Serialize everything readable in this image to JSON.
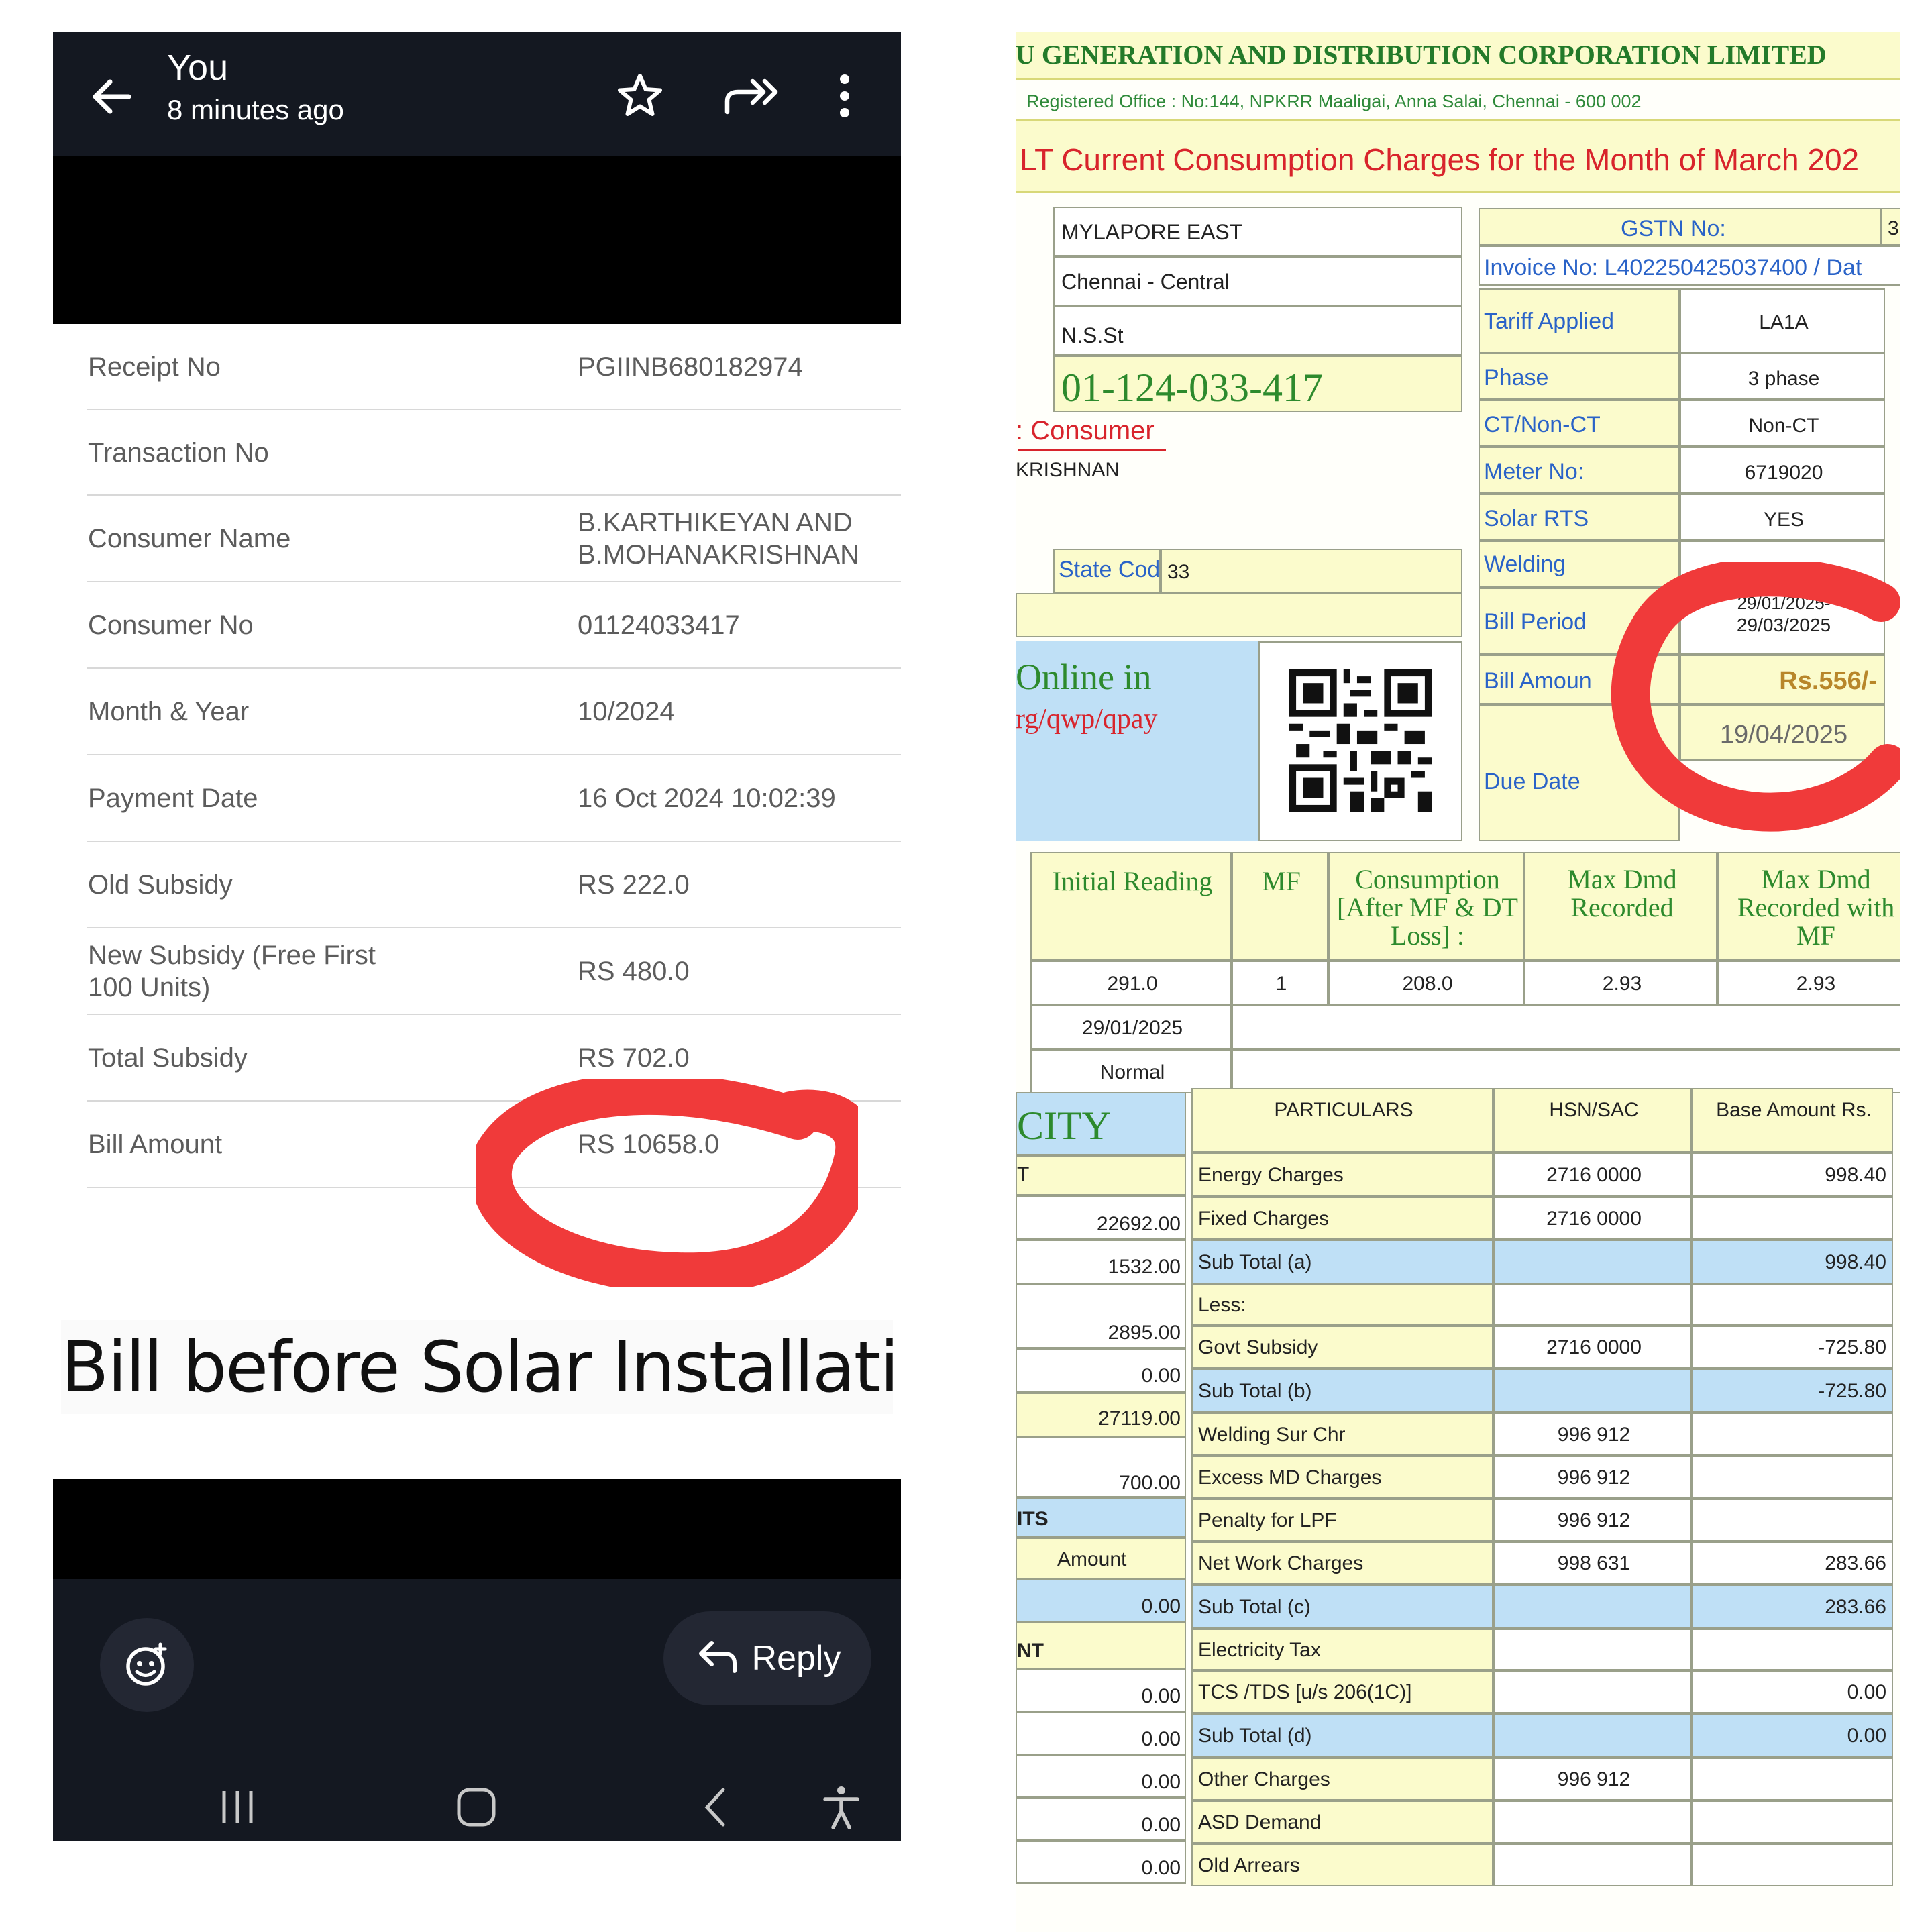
{
  "header": {
    "title": "You",
    "subtitle": "8 minutes ago",
    "icons": [
      "back-arrow-icon",
      "star-icon",
      "forward-icon",
      "more-vert-icon"
    ]
  },
  "receipt": {
    "rows": [
      {
        "label": "Receipt No",
        "value": "PGIINB680182974"
      },
      {
        "label": "Transaction No",
        "value": ""
      },
      {
        "label": "Consumer Name",
        "value_line1": "B.KARTHIKEYAN  AND",
        "value_line2": "B.MOHANAKRISHNAN"
      },
      {
        "label": "Consumer No",
        "value": "01124033417"
      },
      {
        "label": "Month & Year",
        "value": "10/2024"
      },
      {
        "label": "Payment Date",
        "value": "16 Oct 2024 10:02:39"
      },
      {
        "label": "Old Subsidy",
        "value": "RS 222.0"
      },
      {
        "label_line1": "New Subsidy (Free First",
        "label_line2": "100 Units)",
        "value": "RS 480.0"
      },
      {
        "label": "Total Subsidy",
        "value": "RS 702.0"
      },
      {
        "label": "Bill Amount",
        "value": "RS 10658.0"
      }
    ]
  },
  "caption": "Bill before Solar Installation",
  "footer": {
    "reply_label": "Reply",
    "icons": [
      "emoji-add-icon",
      "reply-arrow-icon",
      "recents-icon",
      "home-icon",
      "back-icon",
      "accessibility-icon"
    ]
  },
  "annotation_color": "#f03a3a",
  "bill": {
    "corp_title": "U GENERATION AND DISTRIBUTION CORPORATION LIMITED",
    "registered_office": "Registered Office : No:144, NPKRR Maaligai, Anna Salai, Chennai - 600 002",
    "charges_title": "LT Current Consumption Charges for the Month of March  202",
    "address": {
      "line1": "MYLAPORE EAST",
      "line2": "Chennai - Central",
      "line3": "N.S.St",
      "consumer_no": "01-124-033-417",
      "consumer_label": ": Consumer",
      "consumer_name": "KRISHNAN",
      "state_code_label": "State Code",
      "state_code": "33"
    },
    "pay_online": {
      "line1": "Online in",
      "line2": "rg/qwp/qpay"
    },
    "gstn_label": "GSTN No:",
    "gstn_value": "3",
    "invoice": "Invoice No: L402250425037400 / Dat",
    "details": [
      {
        "label": "Tariff Applied",
        "value": "LA1A"
      },
      {
        "label": "Phase",
        "value": "3 phase"
      },
      {
        "label": "CT/Non-CT",
        "value": "Non-CT"
      },
      {
        "label": "Meter No:",
        "value": "6719020"
      },
      {
        "label": "Solar RTS",
        "value": "YES"
      },
      {
        "label": "Welding",
        "value": ""
      },
      {
        "label": "Bill Period",
        "value": "29/03/2025"
      },
      {
        "label": "Bill Amoun",
        "value": "Rs.556/-"
      },
      {
        "label": "Due Date",
        "value": "19/04/2025"
      }
    ],
    "bill_period_top": "29/01/2025-",
    "reading_headers": [
      "Initial Reading",
      "MF",
      "Consumption [After MF & DT Loss] :",
      "Max Dmd Recorded",
      "Max Dmd Recorded with MF"
    ],
    "reading_row1": [
      "291.0",
      "1",
      "208.0",
      "2.93",
      "2.93"
    ],
    "reading_row2": "29/01/2025",
    "reading_row3": "Normal",
    "left_col": {
      "city": "CITY",
      "marker_t": "T",
      "its": "ITS",
      "amount": "Amount",
      "nt": "NT",
      "values": [
        "22692.00",
        "1532.00",
        "2895.00",
        "0.00",
        "27119.00",
        "700.00",
        "0.00",
        "0.00",
        "0.00",
        "0.00",
        "0.00",
        "0.00"
      ]
    },
    "particulars_headers": [
      "PARTICULARS",
      "HSN/SAC",
      "Base Amount Rs."
    ],
    "particulars": [
      {
        "name": "Energy Charges",
        "hsn": "2716 0000",
        "amount": "998.40"
      },
      {
        "name": "Fixed Charges",
        "hsn": "2716 0000",
        "amount": ""
      },
      {
        "name": "Sub Total (a)",
        "hsn": "",
        "amount": "998.40"
      },
      {
        "name": "Less:",
        "hsn": "",
        "amount": ""
      },
      {
        "name": "Govt Subsidy",
        "hsn": "2716 0000",
        "amount": "-725.80"
      },
      {
        "name": "Sub Total (b)",
        "hsn": "",
        "amount": "-725.80"
      },
      {
        "name": "Welding Sur Chr",
        "hsn": "996 912",
        "amount": ""
      },
      {
        "name": "Excess MD Charges",
        "hsn": "996 912",
        "amount": ""
      },
      {
        "name": "Penalty for LPF",
        "hsn": "996 912",
        "amount": ""
      },
      {
        "name": "Net Work Charges",
        "hsn": "998 631",
        "amount": "283.66"
      },
      {
        "name": "Sub Total (c)",
        "hsn": "",
        "amount": "283.66"
      },
      {
        "name": "Electricity Tax",
        "hsn": "",
        "amount": ""
      },
      {
        "name": "TCS /TDS [u/s 206(1C)]",
        "hsn": "",
        "amount": "0.00"
      },
      {
        "name": "Sub Total (d)",
        "hsn": "",
        "amount": "0.00"
      },
      {
        "name": "Other Charges",
        "hsn": "996 912",
        "amount": ""
      },
      {
        "name": "ASD Demand",
        "hsn": "",
        "amount": ""
      },
      {
        "name": "Old Arrears",
        "hsn": "",
        "amount": ""
      }
    ]
  }
}
